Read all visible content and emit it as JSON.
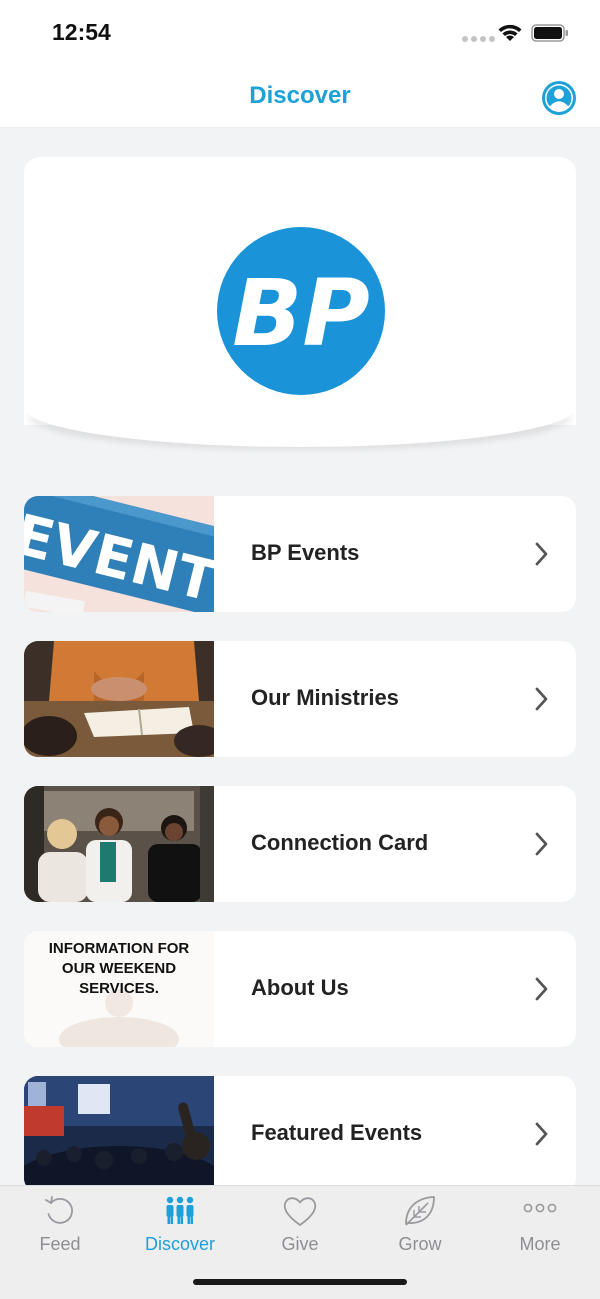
{
  "status": {
    "time": "12:54"
  },
  "nav": {
    "title": "Discover"
  },
  "hero": {
    "logo_text": "BP",
    "brand_color": "#1a93d9"
  },
  "items": [
    {
      "label": "BP Events",
      "thumb_text": "EVENTS"
    },
    {
      "label": "Our Ministries"
    },
    {
      "label": "Connection Card"
    },
    {
      "label": "About Us",
      "thumb_text": [
        "INFORMATION FOR",
        "OUR WEEKEND",
        "SERVICES."
      ]
    },
    {
      "label": "Featured Events"
    }
  ],
  "tabs": [
    {
      "label": "Feed",
      "icon": "refresh-icon"
    },
    {
      "label": "Discover",
      "icon": "people-icon",
      "active": true
    },
    {
      "label": "Give",
      "icon": "heart-icon"
    },
    {
      "label": "Grow",
      "icon": "leaf-icon"
    },
    {
      "label": "More",
      "icon": "more-dots-icon"
    }
  ],
  "colors": {
    "accent": "#1ea0d9",
    "tab_inactive": "#8e8e93"
  }
}
